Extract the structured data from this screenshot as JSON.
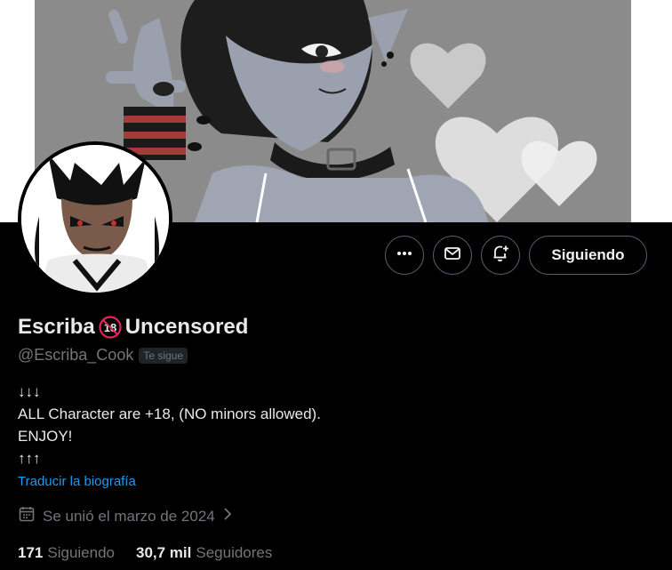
{
  "profile": {
    "display_name_part1": "Escriba",
    "display_name_badge": "18",
    "display_name_part2": "Uncensored",
    "handle": "@Escriba_Cook",
    "follows_you": "Te sigue"
  },
  "actions": {
    "more_icon": "more-horizontal-icon",
    "message_icon": "envelope-icon",
    "notify_icon": "bell-plus-icon",
    "follow_label": "Siguiendo"
  },
  "bio": {
    "lines": [
      "↓↓↓",
      "ALL Character are +18, (NO minors allowed).",
      "ENJOY!",
      "↑↑↑"
    ],
    "translate": "Traducir la biografía"
  },
  "joined": {
    "icon": "calendar-icon",
    "text": "Se unió el marzo de 2024"
  },
  "stats": {
    "following_count": "171",
    "following_label": "Siguiendo",
    "followers_count": "30,7 mil",
    "followers_label": "Seguidores"
  },
  "colors": {
    "accent": "#1d9bf0",
    "muted": "#71767b",
    "border": "#536471",
    "no18_red": "#e0245e"
  }
}
